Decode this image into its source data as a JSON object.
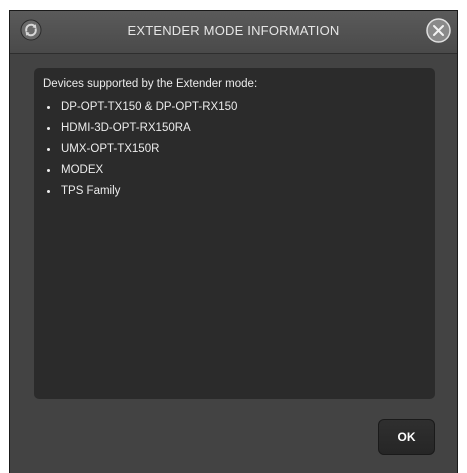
{
  "dialog": {
    "title": "EXTENDER MODE INFORMATION",
    "icons": {
      "app": "refresh-icon",
      "close": "close-icon"
    }
  },
  "content": {
    "intro": "Devices supported by the Extender mode:",
    "devices": [
      "DP-OPT-TX150 & DP-OPT-RX150",
      "HDMI-3D-OPT-RX150RA",
      "UMX-OPT-TX150R",
      "MODEX",
      "TPS Family"
    ]
  },
  "buttons": {
    "ok": "OK"
  },
  "colors": {
    "dialog_bg": "#434343",
    "content_bg": "#2b2b2b",
    "text": "#ececec"
  }
}
